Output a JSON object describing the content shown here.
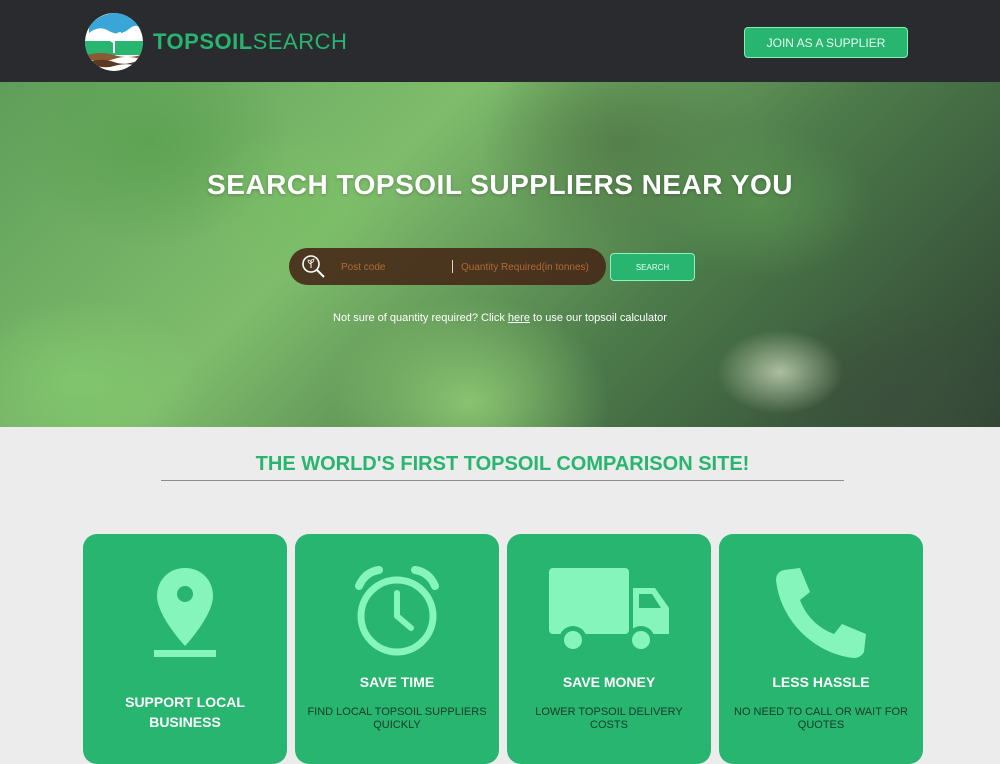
{
  "header": {
    "logo_bold": "TOPSOIL",
    "logo_light": "SEARCH",
    "join_button": "JOIN AS A SUPPLIER"
  },
  "hero": {
    "title": "SEARCH TOPSOIL SUPPLIERS NEAR YOU",
    "postcode_placeholder": "Post code",
    "quantity_placeholder": "Quantity Required(in tonnes)",
    "search_button": "SEARCH",
    "calc_prefix": "Not sure of quantity required? Click",
    "calc_link": "here",
    "calc_suffix": "to use our topsoil calculator"
  },
  "section": {
    "title": "THE WORLD'S FIRST TOPSOIL COMPARISON SITE!"
  },
  "cards": [
    {
      "title": "SUPPORT LOCAL BUSINESS",
      "subtitle": "",
      "icon": "map-pin-icon"
    },
    {
      "title": "SAVE TIME",
      "subtitle": "FIND LOCAL TOPSOIL SUPPLIERS QUICKLY",
      "icon": "alarm-clock-icon"
    },
    {
      "title": "SAVE MONEY",
      "subtitle": "LOWER TOPSOIL DELIVERY COSTS",
      "icon": "truck-icon"
    },
    {
      "title": "LESS HASSLE",
      "subtitle": "NO NEED TO CALL OR WAIT FOR QUOTES",
      "icon": "phone-icon"
    }
  ],
  "colors": {
    "brand_green": "#27b56f",
    "icon_mint": "#86f5bb",
    "header_bg": "#2a2b2f",
    "page_bg": "#ececec"
  }
}
